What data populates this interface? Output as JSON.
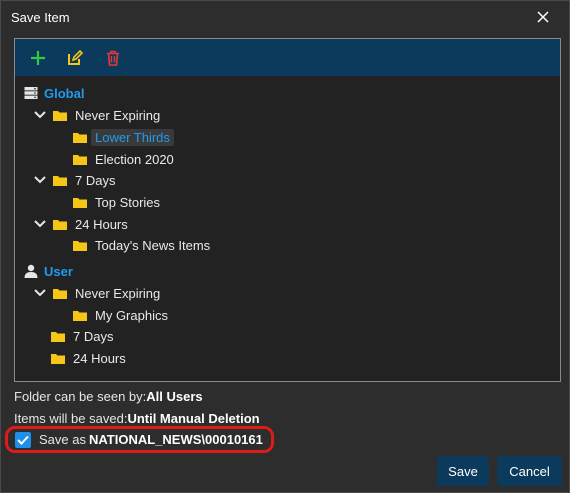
{
  "window": {
    "title": "Save Item",
    "close_icon": "close-icon"
  },
  "toolbar": {
    "add_icon": "plus-icon",
    "edit_icon": "edit-icon",
    "delete_icon": "trash-icon",
    "colors": {
      "background": "#0b3a5d",
      "add": "#2ecc40",
      "edit": "#f5c518",
      "delete": "#e53935"
    }
  },
  "tree": {
    "global": {
      "label": "Global",
      "icon": "server-icon",
      "never_expiring": {
        "label": "Never Expiring",
        "children": [
          "Lower Thirds",
          "Election 2020"
        ],
        "selected": "Lower Thirds"
      },
      "seven_days": {
        "label": "7 Days",
        "children": [
          "Top Stories"
        ]
      },
      "twenty_four_hours": {
        "label": "24 Hours",
        "children": [
          "Today's News Items"
        ]
      }
    },
    "user": {
      "label": "User",
      "icon": "user-icon",
      "never_expiring": {
        "label": "Never Expiring",
        "children": [
          "My Graphics"
        ]
      },
      "seven_days": {
        "label": "7 Days"
      },
      "twenty_four_hours": {
        "label": "24 Hours"
      }
    }
  },
  "info": {
    "visibility_label": "Folder can be seen by:",
    "visibility_value": "All Users",
    "saved_label": "Items will be saved:",
    "saved_value": "Until Manual Deletion"
  },
  "save_as": {
    "checked": true,
    "label": "Save as",
    "value": "NATIONAL_NEWS\\00010161"
  },
  "buttons": {
    "save": "Save",
    "cancel": "Cancel"
  },
  "colors": {
    "accent": "#1e9cf0",
    "folder": "#f5c518",
    "highlight": "#e01919",
    "button": "#0b3a5d"
  }
}
